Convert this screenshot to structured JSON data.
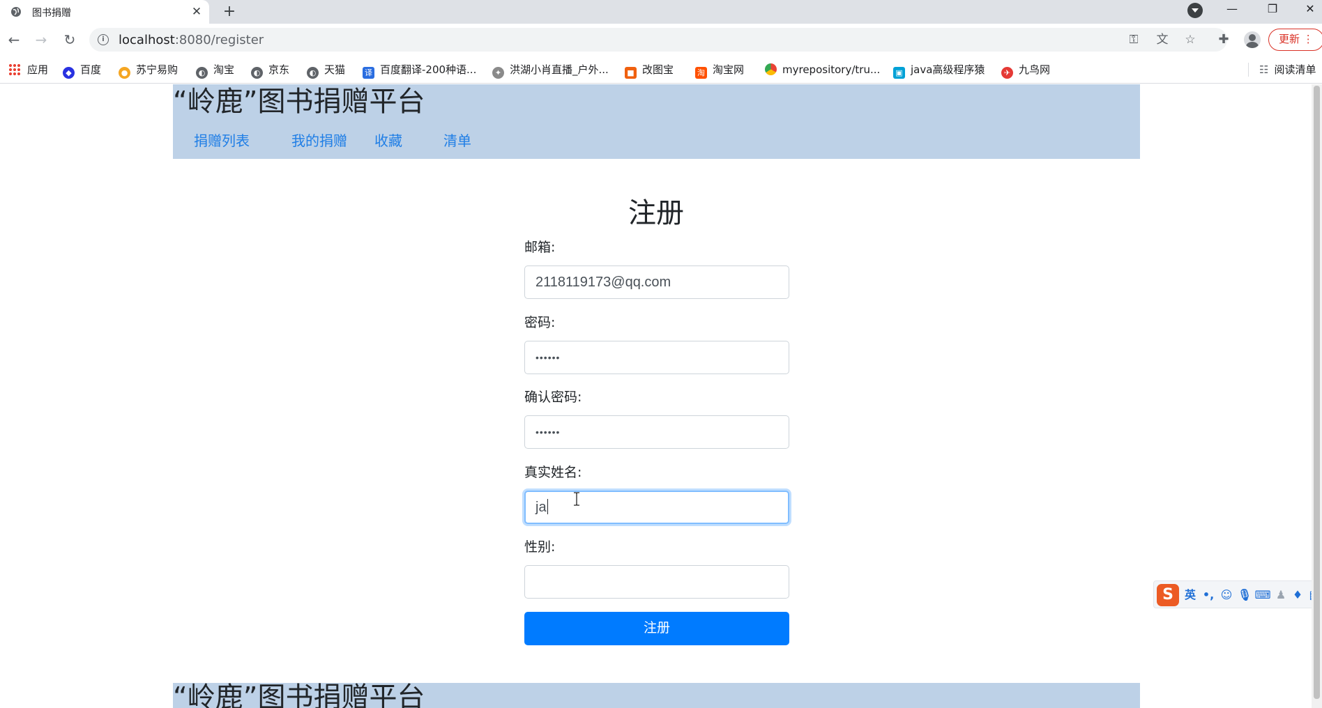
{
  "browser": {
    "tab_title": "图书捐赠",
    "tab_close": "✕",
    "new_tab": "+",
    "url_host": "localhost",
    "url_path": ":8080/register",
    "update_label": "更新",
    "menu_icon": "⋮"
  },
  "bookmarks": {
    "items": [
      {
        "label": "应用",
        "icon": "apps-grid-icon"
      },
      {
        "label": "百度",
        "icon": "baidu-paw-icon"
      },
      {
        "label": "苏宁易购",
        "icon": "suning-icon"
      },
      {
        "label": "淘宝",
        "icon": "globe-icon"
      },
      {
        "label": "京东",
        "icon": "globe-icon"
      },
      {
        "label": "天猫",
        "icon": "globe-icon"
      },
      {
        "label": "百度翻译-200种语...",
        "icon": "translate-icon"
      },
      {
        "label": "洪湖小肖直播_户外...",
        "icon": "bird-icon"
      },
      {
        "label": "改图宝",
        "icon": "gaitubao-icon"
      },
      {
        "label": "淘宝网",
        "icon": "taobao-icon"
      },
      {
        "label": "myrepository/tru...",
        "icon": "chrome-icon"
      },
      {
        "label": "java高级程序猿",
        "icon": "bilibili-icon"
      },
      {
        "label": "九鸟网",
        "icon": "bird-red-icon"
      }
    ],
    "reading_list": "阅读清单"
  },
  "site": {
    "title": "“岭鹿”图书捐赠平台",
    "nav": [
      "捐赠列表",
      "我的捐赠",
      "收藏",
      "清单"
    ],
    "footer_title": "“岭鹿”图书捐赠平台"
  },
  "form": {
    "title": "注册",
    "email_label": "邮箱:",
    "email_value": "2118119173@qq.com",
    "password_label": "密码:",
    "password_value": "••••••",
    "confirm_label": "确认密码:",
    "confirm_value": "••••••",
    "realname_label": "真实姓名:",
    "realname_value": "ja",
    "gender_label": "性别:",
    "gender_value": "",
    "submit_label": "注册"
  },
  "ime": {
    "logo": "S",
    "mode": "英",
    "punct": "•,",
    "items": [
      "emoji-icon",
      "microphone-icon",
      "keyboard-icon",
      "user-icon",
      "shirt-icon",
      "grid-icon"
    ]
  },
  "colors": {
    "header_bg": "#bdd1e7",
    "nav_link": "#1f7ee6",
    "primary_button": "#007bff",
    "focus_ring": "#80bdff"
  }
}
